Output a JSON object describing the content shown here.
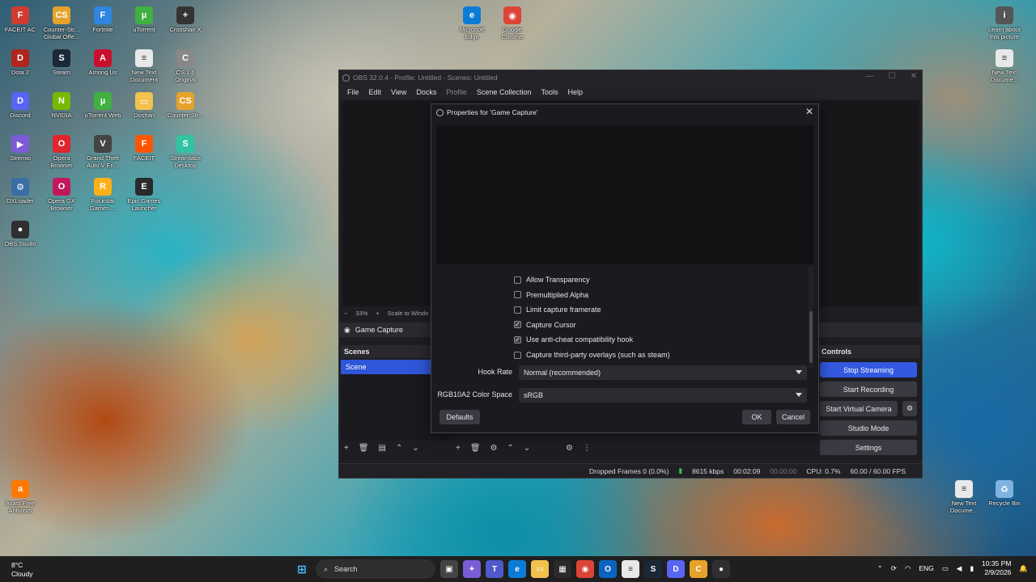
{
  "desktop": {
    "icons_left": [
      {
        "label": "FACEIT AC",
        "color": "#d13b2e",
        "glyph": "F"
      },
      {
        "label": "Counter-Str...\nGlobal Offe...",
        "color": "#e6a22a",
        "glyph": "CS"
      },
      {
        "label": "Fortnite",
        "color": "#2e86de",
        "glyph": "F"
      },
      {
        "label": "uTorrent",
        "color": "#40b040",
        "glyph": "µ"
      },
      {
        "label": "Crosshair X",
        "color": "#333",
        "glyph": "+"
      },
      {
        "label": "Dota 2",
        "color": "#b0261e",
        "glyph": "D"
      },
      {
        "label": "Steam",
        "color": "#1b2838",
        "glyph": "S"
      },
      {
        "label": "Among Us",
        "color": "#c8102e",
        "glyph": "A"
      },
      {
        "label": "New Text\nDocument",
        "color": "#e8e8e8",
        "glyph": "≡"
      },
      {
        "label": "CS 1.6\nOriginal",
        "color": "#888",
        "glyph": "C"
      },
      {
        "label": "Discord",
        "color": "#5865f2",
        "glyph": "D"
      },
      {
        "label": "NVIDIA",
        "color": "#76b900",
        "glyph": "N"
      },
      {
        "label": "uTorrent Web",
        "color": "#40b040",
        "glyph": "µ"
      },
      {
        "label": "Doshan",
        "color": "#f2c14e",
        "glyph": "▭"
      },
      {
        "label": "Counter-Str...",
        "color": "#e6a22a",
        "glyph": "CS"
      },
      {
        "label": "Stremio",
        "color": "#7b5bd6",
        "glyph": "▶"
      },
      {
        "label": "Opera\nBrowser",
        "color": "#e0252e",
        "glyph": "O"
      },
      {
        "label": "Grand Theft\nAuto V En...",
        "color": "#444",
        "glyph": "V"
      },
      {
        "label": "FACEIT",
        "color": "#ff5500",
        "glyph": "F"
      },
      {
        "label": "Streamlabs\nDesktop",
        "color": "#31c3a2",
        "glyph": "S"
      },
      {
        "label": "DXLoader",
        "color": "#3a6ea5",
        "glyph": "⚙"
      },
      {
        "label": "Opera GX\nBrowser",
        "color": "#c2185b",
        "glyph": "O"
      },
      {
        "label": "Rockstar\nGames ...",
        "color": "#fcaf17",
        "glyph": "R"
      },
      {
        "label": "Epic Games\nLauncher",
        "color": "#2a2a2a",
        "glyph": "E"
      },
      {
        "label": "OBS Studio",
        "color": "#302e31",
        "glyph": "●"
      },
      {
        "label": "Avast Free\nAntivirus",
        "color": "#ff7800",
        "glyph": "a"
      }
    ],
    "icons_top": [
      {
        "label": "Microsoft\nEdge",
        "color": "#0c7bd6",
        "glyph": "e"
      },
      {
        "label": "Google\nChrome",
        "color": "#db4437",
        "glyph": "◉"
      }
    ],
    "icons_right": [
      {
        "label": "Learn about\nthis picture",
        "color": "#555",
        "glyph": "i"
      },
      {
        "label": "New Text\nDocume...",
        "color": "#e8e8e8",
        "glyph": "≡"
      },
      {
        "label": "New Text\nDocume...",
        "color": "#e8e8e8",
        "glyph": "≡"
      },
      {
        "label": "Recycle Bin",
        "color": "#7fb3e0",
        "glyph": "♻"
      }
    ]
  },
  "obs": {
    "title": "OBS 32.0.4 - Profile: Untitled - Scenes: Untitled",
    "menu": [
      "File",
      "Edit",
      "View",
      "Docks",
      "Profile",
      "Scene Collection",
      "Tools",
      "Help"
    ],
    "zoom": "33%",
    "scale_label": "Scale to Windo",
    "source_name": "Game Capture",
    "scenes_header": "Scenes",
    "scene_item": "Scene",
    "controls_header": "Controls",
    "controls": [
      "Stop Streaming",
      "Start Recording",
      "Start Virtual Camera",
      "Studio Mode",
      "Settings"
    ],
    "status": {
      "dropped": "Dropped Frames 0 (0.0%)",
      "bitrate": "8615 kbps",
      "stream_time": "00:02:09",
      "rec_time": "00:00:00",
      "cpu": "CPU: 0.7%",
      "fps": "60.00 / 60.00 FPS"
    }
  },
  "dialog": {
    "title": "Properties for 'Game Capture'",
    "checkboxes": [
      {
        "label": "Allow Transparency",
        "checked": false
      },
      {
        "label": "Premultiplied Alpha",
        "checked": false
      },
      {
        "label": "Limit capture framerate",
        "checked": false
      },
      {
        "label": "Capture Cursor",
        "checked": true
      },
      {
        "label": "Use anti-cheat compatibility hook",
        "checked": true
      },
      {
        "label": "Capture third-party overlays (such as steam)",
        "checked": false
      }
    ],
    "hook_rate_label": "Hook Rate",
    "hook_rate_value": "Normal (recommended)",
    "color_space_label": "RGB10A2 Color Space",
    "color_space_value": "sRGB",
    "defaults_label": "Defaults",
    "ok_label": "OK",
    "cancel_label": "Cancel"
  },
  "taskbar": {
    "weather_temp": "8°C",
    "weather_desc": "Cloudy",
    "search_label": "Search",
    "language": "ENG",
    "time": "10:35 PM",
    "date": "2/9/2026"
  }
}
